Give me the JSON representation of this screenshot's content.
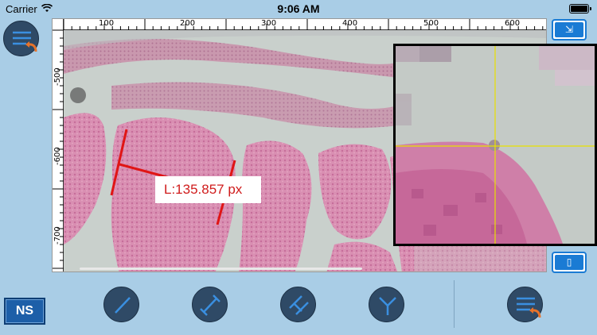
{
  "status_bar": {
    "carrier": "Carrier",
    "time": "9:06 AM"
  },
  "ruler": {
    "top_labels": [
      "100",
      "200",
      "300",
      "400",
      "500",
      "600"
    ],
    "left_labels": [
      "-500",
      "-600",
      "-700"
    ]
  },
  "measurement": {
    "label": "L:135.857 px",
    "color": "#d01c1c"
  },
  "magnifier": {
    "crosshair_color": "#e8e000"
  },
  "toolbar": {
    "ns_label": "NS",
    "side_top_icon": "⇲",
    "side_bottom_icon": "▯",
    "tools": [
      "line-tool-icon",
      "caliper-tool-icon",
      "parallel-lines-tool-icon",
      "angle-tool-icon"
    ]
  },
  "colors": {
    "background": "#a9cde6",
    "button_dark": "#2f4a66",
    "accent_blue": "#1a7bd4",
    "accent_orange": "#e8732a"
  }
}
